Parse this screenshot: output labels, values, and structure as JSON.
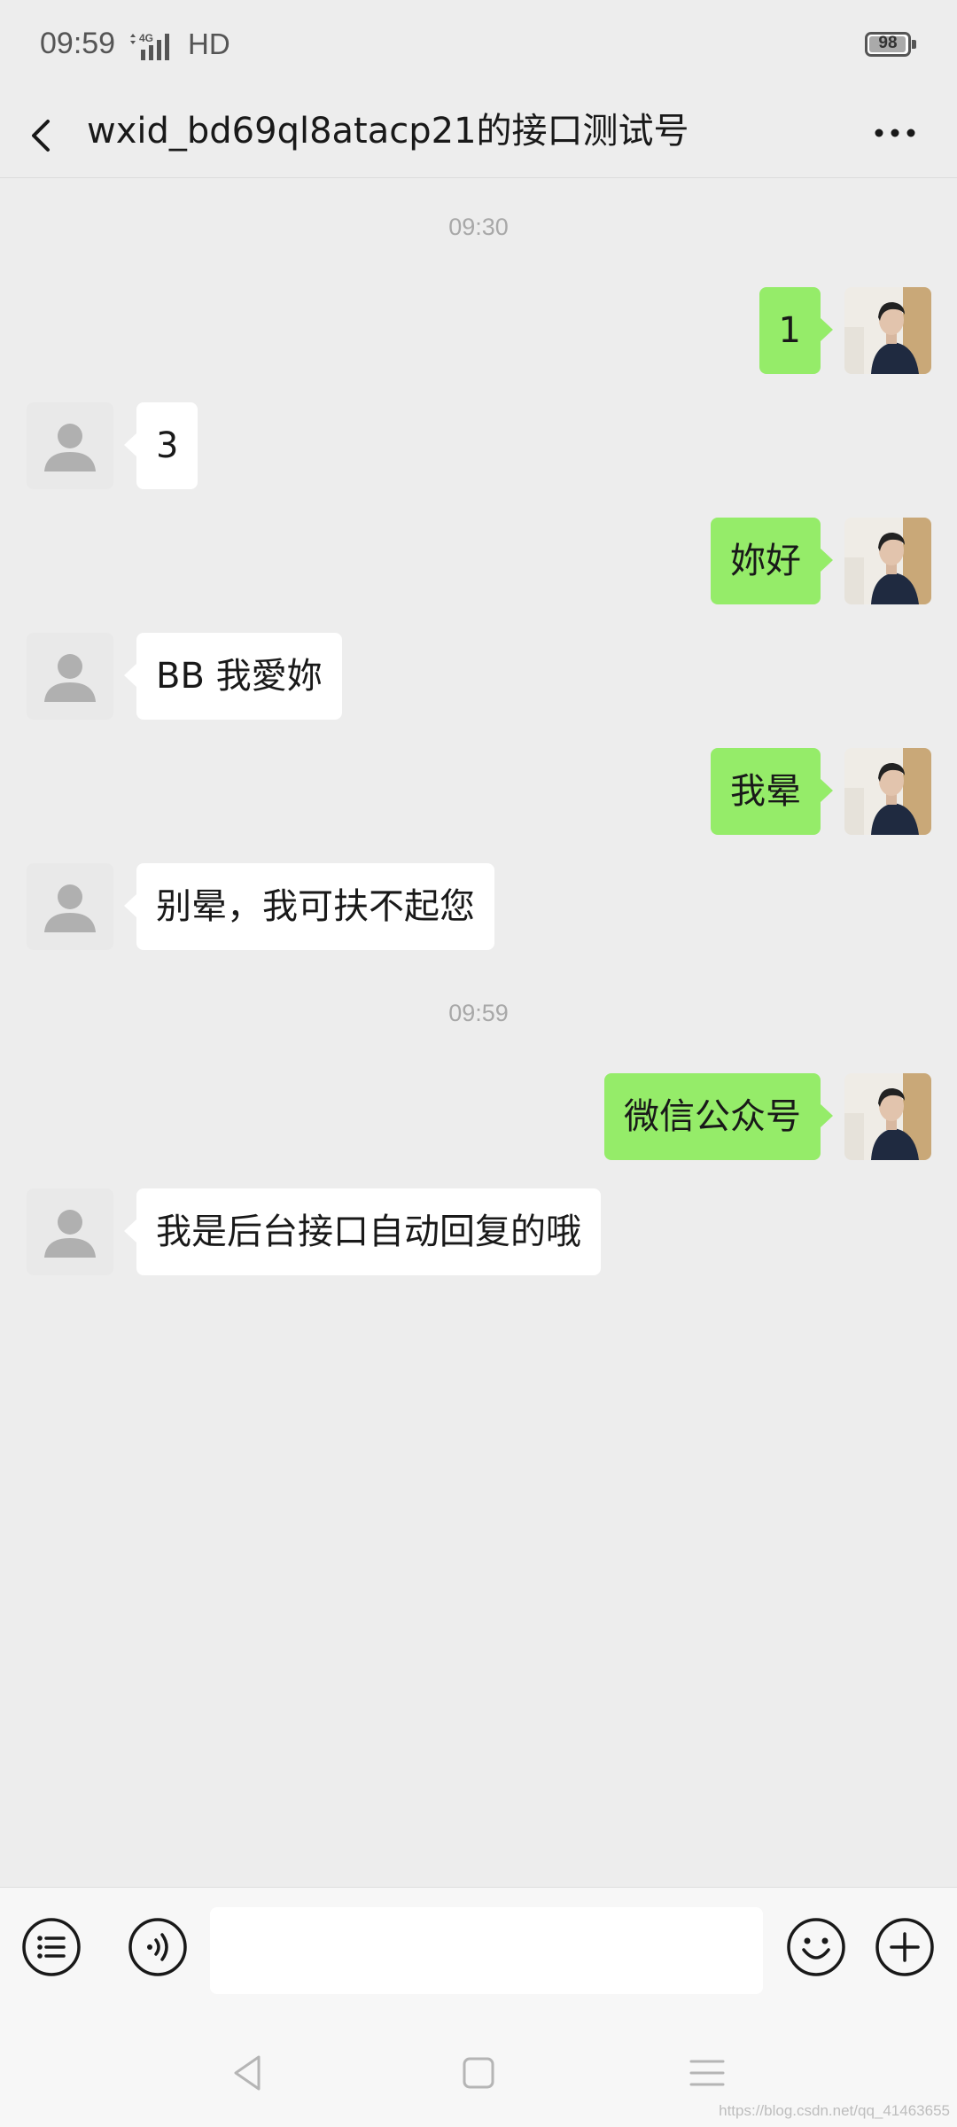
{
  "status_bar": {
    "time": "09:59",
    "network_label": "HD",
    "network_type": "4G",
    "battery_percent": "98",
    "battery_level": 0.98
  },
  "nav": {
    "title": "wxid_bd69ql8atacp21的接口测试号",
    "back_icon": "chevron-left-icon",
    "more_icon": "more-dots-icon"
  },
  "chat": {
    "time_labels": [
      "09:30",
      "09:59"
    ],
    "messages": [
      {
        "from": "user",
        "text": "1"
      },
      {
        "from": "bot",
        "text": "3"
      },
      {
        "from": "user",
        "text": "妳好"
      },
      {
        "from": "bot",
        "text": "BB 我愛妳"
      },
      {
        "from": "user",
        "text": "我晕"
      },
      {
        "from": "bot",
        "text": "别晕，我可扶不起您"
      },
      {
        "from": "user",
        "text": "微信公众号"
      },
      {
        "from": "bot",
        "text": "我是后台接口自动回复的哦"
      }
    ]
  },
  "input_bar": {
    "value": "",
    "icons": [
      "menu-list-icon",
      "voice-icon",
      "emoji-icon",
      "plus-icon"
    ]
  },
  "system_nav": {
    "icons": [
      "back-triangle-icon",
      "home-square-icon",
      "recents-menu-icon"
    ]
  },
  "watermark": "https://blog.csdn.net/qq_41463655",
  "colors": {
    "background": "#ededed",
    "bubble_out": "#95ec69",
    "bubble_in": "#ffffff",
    "time_label": "#a8a8a8"
  }
}
